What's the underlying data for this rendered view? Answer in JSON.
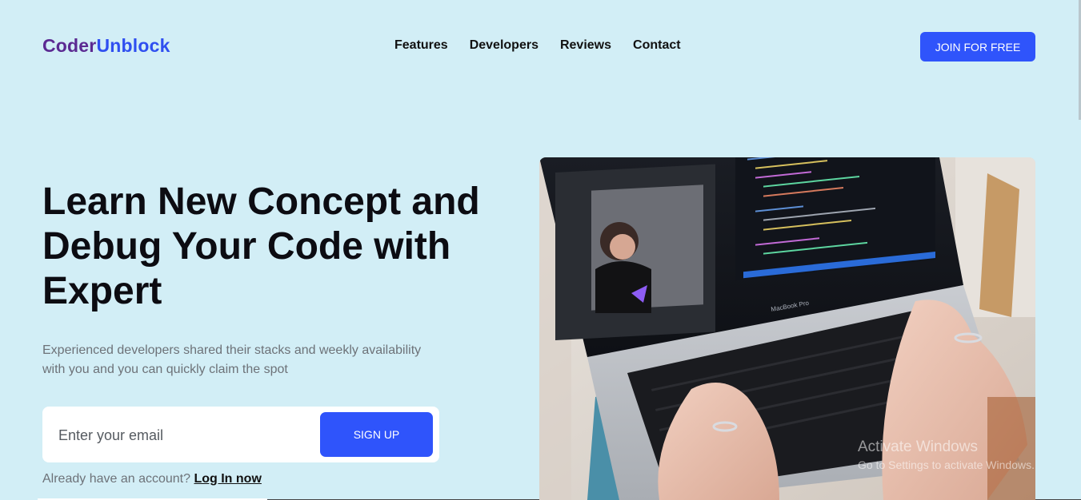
{
  "header": {
    "logo_part1": "Coder",
    "logo_part2": "Unblock",
    "nav": [
      "Features",
      "Developers",
      "Reviews",
      "Contact"
    ],
    "join_label": "JOIN FOR FREE"
  },
  "hero": {
    "title_line1": "Learn New Concept and",
    "title_line2": "Debug Your Code with",
    "title_line3": "Expert",
    "subtitle_line1": "Experienced developers shared their stacks and weekly availability",
    "subtitle_line2": "with you and you can quickly claim the spot",
    "email_placeholder": "Enter your email",
    "signup_label": "SIGN UP",
    "login_prompt": "Already have an account?",
    "login_link": "Log In now"
  },
  "image": {
    "laptop_label": "MacBook Pro"
  },
  "watermark": {
    "line1": "Activate Windows",
    "line2": "Go to Settings to activate Windows."
  },
  "colors": {
    "background": "#d2eef6",
    "accent": "#2f54fb",
    "logo_purple": "#5b2a92",
    "logo_blue": "#2f4ff0"
  }
}
